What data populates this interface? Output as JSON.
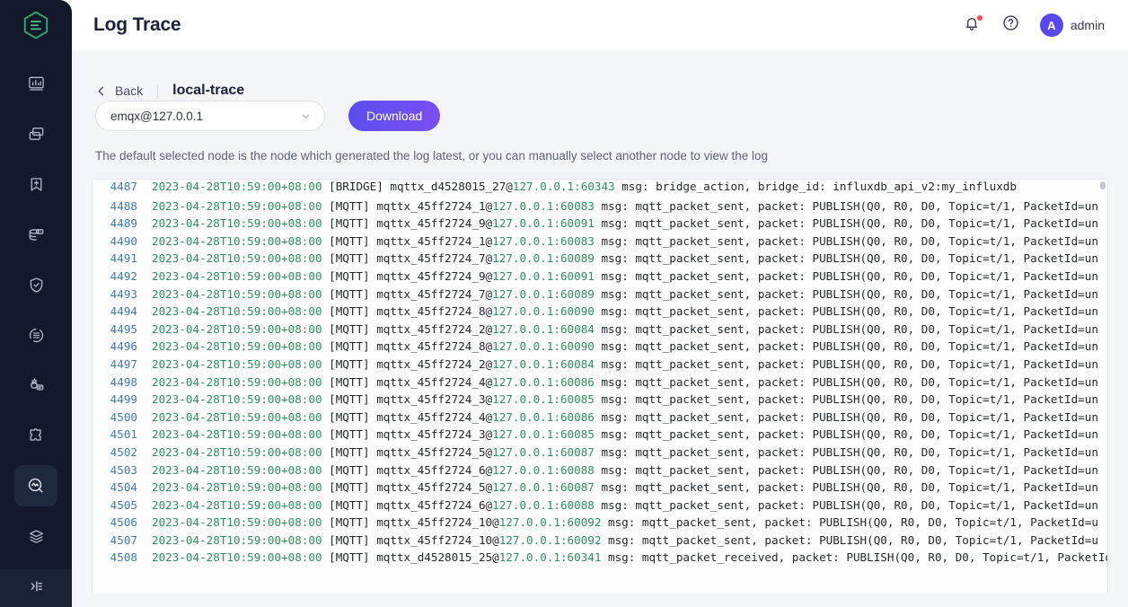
{
  "sidebar": {
    "logo": "emqx-logo",
    "items": [
      {
        "name": "dashboard",
        "icon": "chart-monitor-icon"
      },
      {
        "name": "clients",
        "icon": "copy-layers-icon"
      },
      {
        "name": "rules",
        "icon": "bookmark-plus-icon"
      },
      {
        "name": "data-integration",
        "icon": "database-plug-icon"
      },
      {
        "name": "access-control",
        "icon": "shield-check-icon"
      },
      {
        "name": "retained",
        "icon": "stack-refresh-icon"
      },
      {
        "name": "management",
        "icon": "gear-chat-icon"
      },
      {
        "name": "extensions",
        "icon": "puzzle-icon"
      },
      {
        "name": "diagnose",
        "icon": "analysis-search-icon",
        "active": true
      },
      {
        "name": "configuration",
        "icon": "layers-icon"
      }
    ],
    "collapse": {
      "name": "collapse-sidebar",
      "icon": "collapse-panel-icon"
    }
  },
  "header": {
    "title": "Log Trace",
    "bell_icon": "bell-icon",
    "has_notification": true,
    "help_icon": "question-circle-icon",
    "avatar_letter": "A",
    "user_name": "admin"
  },
  "breadcrumb": {
    "back_label": "Back",
    "back_icon": "chevron-left-icon",
    "current": "local-trace"
  },
  "controls": {
    "node_select": {
      "value": "emqx@127.0.0.1",
      "caret_icon": "chevron-down-icon"
    },
    "download_label": "Download"
  },
  "hint": "The default selected node is the node which generated the log latest, or you can manually select another node to view the log",
  "colors": {
    "accent": "#5b4df0",
    "sidebar_bg": "#11192b",
    "sidebar_active": "#1e293d",
    "logo_green": "#3f9e6b",
    "log_linenum": "#3f7cb3",
    "log_green": "#2f8f63",
    "log_text": "#24292e",
    "notification_dot": "#ff4d4f"
  },
  "log": {
    "scrollbar": {
      "name": "log-vertical-scrollbar",
      "thumb_top_pct": 0
    },
    "lines": [
      {
        "n": "4487",
        "partial": true,
        "date": "2023-04-28T10:59:00+08:00",
        "tag": "[BRIDGE]",
        "client": "mqttx_d4528015_27@",
        "ip": "127.0.0.1:60343",
        "rest": " msg: bridge_action, bridge_id: influxdb_api_v2:my_influxdb"
      },
      {
        "n": "4488",
        "date": "2023-04-28T10:59:00+08:00",
        "tag": "[MQTT]",
        "client": "mqttx_45ff2724_1@",
        "ip": "127.0.0.1:60083",
        "rest": " msg: mqtt_packet_sent, packet: PUBLISH(Q0, R0, D0, Topic=t/1, PacketId=un"
      },
      {
        "n": "4489",
        "date": "2023-04-28T10:59:00+08:00",
        "tag": "[MQTT]",
        "client": "mqttx_45ff2724_9@",
        "ip": "127.0.0.1:60091",
        "rest": " msg: mqtt_packet_sent, packet: PUBLISH(Q0, R0, D0, Topic=t/1, PacketId=un"
      },
      {
        "n": "4490",
        "date": "2023-04-28T10:59:00+08:00",
        "tag": "[MQTT]",
        "client": "mqttx_45ff2724_1@",
        "ip": "127.0.0.1:60083",
        "rest": " msg: mqtt_packet_sent, packet: PUBLISH(Q0, R0, D0, Topic=t/1, PacketId=un"
      },
      {
        "n": "4491",
        "date": "2023-04-28T10:59:00+08:00",
        "tag": "[MQTT]",
        "client": "mqttx_45ff2724_7@",
        "ip": "127.0.0.1:60089",
        "rest": " msg: mqtt_packet_sent, packet: PUBLISH(Q0, R0, D0, Topic=t/1, PacketId=un"
      },
      {
        "n": "4492",
        "date": "2023-04-28T10:59:00+08:00",
        "tag": "[MQTT]",
        "client": "mqttx_45ff2724_9@",
        "ip": "127.0.0.1:60091",
        "rest": " msg: mqtt_packet_sent, packet: PUBLISH(Q0, R0, D0, Topic=t/1, PacketId=un"
      },
      {
        "n": "4493",
        "date": "2023-04-28T10:59:00+08:00",
        "tag": "[MQTT]",
        "client": "mqttx_45ff2724_7@",
        "ip": "127.0.0.1:60089",
        "rest": " msg: mqtt_packet_sent, packet: PUBLISH(Q0, R0, D0, Topic=t/1, PacketId=un"
      },
      {
        "n": "4494",
        "date": "2023-04-28T10:59:00+08:00",
        "tag": "[MQTT]",
        "client": "mqttx_45ff2724_8@",
        "ip": "127.0.0.1:60090",
        "rest": " msg: mqtt_packet_sent, packet: PUBLISH(Q0, R0, D0, Topic=t/1, PacketId=un"
      },
      {
        "n": "4495",
        "date": "2023-04-28T10:59:00+08:00",
        "tag": "[MQTT]",
        "client": "mqttx_45ff2724_2@",
        "ip": "127.0.0.1:60084",
        "rest": " msg: mqtt_packet_sent, packet: PUBLISH(Q0, R0, D0, Topic=t/1, PacketId=un"
      },
      {
        "n": "4496",
        "date": "2023-04-28T10:59:00+08:00",
        "tag": "[MQTT]",
        "client": "mqttx_45ff2724_8@",
        "ip": "127.0.0.1:60090",
        "rest": " msg: mqtt_packet_sent, packet: PUBLISH(Q0, R0, D0, Topic=t/1, PacketId=un"
      },
      {
        "n": "4497",
        "date": "2023-04-28T10:59:00+08:00",
        "tag": "[MQTT]",
        "client": "mqttx_45ff2724_2@",
        "ip": "127.0.0.1:60084",
        "rest": " msg: mqtt_packet_sent, packet: PUBLISH(Q0, R0, D0, Topic=t/1, PacketId=un"
      },
      {
        "n": "4498",
        "date": "2023-04-28T10:59:00+08:00",
        "tag": "[MQTT]",
        "client": "mqttx_45ff2724_4@",
        "ip": "127.0.0.1:60086",
        "rest": " msg: mqtt_packet_sent, packet: PUBLISH(Q0, R0, D0, Topic=t/1, PacketId=un"
      },
      {
        "n": "4499",
        "date": "2023-04-28T10:59:00+08:00",
        "tag": "[MQTT]",
        "client": "mqttx_45ff2724_3@",
        "ip": "127.0.0.1:60085",
        "rest": " msg: mqtt_packet_sent, packet: PUBLISH(Q0, R0, D0, Topic=t/1, PacketId=un"
      },
      {
        "n": "4500",
        "date": "2023-04-28T10:59:00+08:00",
        "tag": "[MQTT]",
        "client": "mqttx_45ff2724_4@",
        "ip": "127.0.0.1:60086",
        "rest": " msg: mqtt_packet_sent, packet: PUBLISH(Q0, R0, D0, Topic=t/1, PacketId=un"
      },
      {
        "n": "4501",
        "date": "2023-04-28T10:59:00+08:00",
        "tag": "[MQTT]",
        "client": "mqttx_45ff2724_3@",
        "ip": "127.0.0.1:60085",
        "rest": " msg: mqtt_packet_sent, packet: PUBLISH(Q0, R0, D0, Topic=t/1, PacketId=un"
      },
      {
        "n": "4502",
        "date": "2023-04-28T10:59:00+08:00",
        "tag": "[MQTT]",
        "client": "mqttx_45ff2724_5@",
        "ip": "127.0.0.1:60087",
        "rest": " msg: mqtt_packet_sent, packet: PUBLISH(Q0, R0, D0, Topic=t/1, PacketId=un"
      },
      {
        "n": "4503",
        "date": "2023-04-28T10:59:00+08:00",
        "tag": "[MQTT]",
        "client": "mqttx_45ff2724_6@",
        "ip": "127.0.0.1:60088",
        "rest": " msg: mqtt_packet_sent, packet: PUBLISH(Q0, R0, D0, Topic=t/1, PacketId=un"
      },
      {
        "n": "4504",
        "date": "2023-04-28T10:59:00+08:00",
        "tag": "[MQTT]",
        "client": "mqttx_45ff2724_5@",
        "ip": "127.0.0.1:60087",
        "rest": " msg: mqtt_packet_sent, packet: PUBLISH(Q0, R0, D0, Topic=t/1, PacketId=un"
      },
      {
        "n": "4505",
        "date": "2023-04-28T10:59:00+08:00",
        "tag": "[MQTT]",
        "client": "mqttx_45ff2724_6@",
        "ip": "127.0.0.1:60088",
        "rest": " msg: mqtt_packet_sent, packet: PUBLISH(Q0, R0, D0, Topic=t/1, PacketId=un"
      },
      {
        "n": "4506",
        "date": "2023-04-28T10:59:00+08:00",
        "tag": "[MQTT]",
        "client": "mqttx_45ff2724_10@",
        "ip": "127.0.0.1:60092",
        "rest": " msg: mqtt_packet_sent, packet: PUBLISH(Q0, R0, D0, Topic=t/1, PacketId=u"
      },
      {
        "n": "4507",
        "date": "2023-04-28T10:59:00+08:00",
        "tag": "[MQTT]",
        "client": "mqttx_45ff2724_10@",
        "ip": "127.0.0.1:60092",
        "rest": " msg: mqtt_packet_sent, packet: PUBLISH(Q0, R0, D0, Topic=t/1, PacketId=u"
      },
      {
        "n": "4508",
        "partial": true,
        "date": "2023-04-28T10:59:00+08:00",
        "tag": "[MQTT]",
        "client": "mqttx_d4528015_25@",
        "ip": "127.0.0.1:60341",
        "rest": " msg: mqtt_packet_received, packet: PUBLISH(Q0, R0, D0, Topic=t/1, PacketId"
      }
    ]
  }
}
